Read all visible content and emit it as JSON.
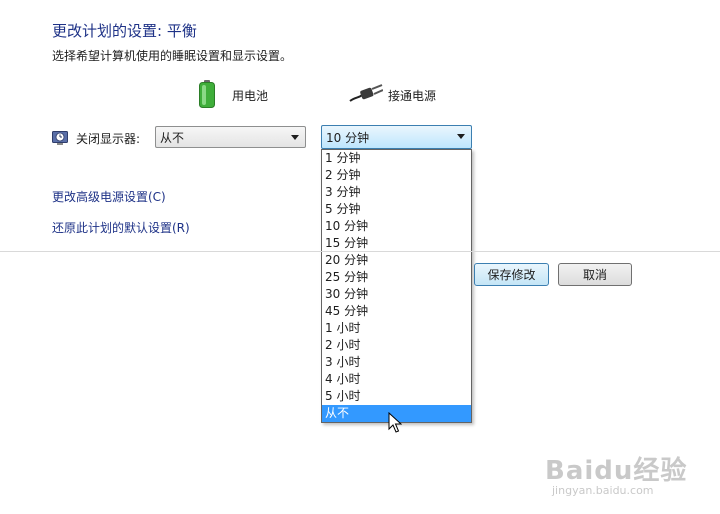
{
  "header": {
    "title": "更改计划的设置: 平衡",
    "subtitle": "选择希望计算机使用的睡眠设置和显示设置。"
  },
  "columns": {
    "battery_label": "用电池",
    "plugged_label": "接通电源"
  },
  "display_row": {
    "label": "关闭显示器:",
    "battery_value": "从不",
    "plugged_value": "10 分钟"
  },
  "dropdown": {
    "options": [
      "1 分钟",
      "2 分钟",
      "3 分钟",
      "5 分钟",
      "10 分钟",
      "15 分钟",
      "20 分钟",
      "25 分钟",
      "30 分钟",
      "45 分钟",
      "1 小时",
      "2 小时",
      "3 小时",
      "4 小时",
      "5 小时",
      "从不"
    ],
    "highlighted": "从不"
  },
  "links": {
    "advanced": "更改高级电源设置(C)",
    "restore": "还原此计划的默认设置(R)"
  },
  "buttons": {
    "save": "保存修改",
    "cancel": "取消"
  },
  "watermark": {
    "logo": "Baidu经验",
    "url": "jingyan.baidu.com"
  },
  "colors": {
    "title": "#1e3287",
    "link": "#1e3287",
    "highlight": "#3399ff",
    "battery_green": "#3fae3a"
  }
}
